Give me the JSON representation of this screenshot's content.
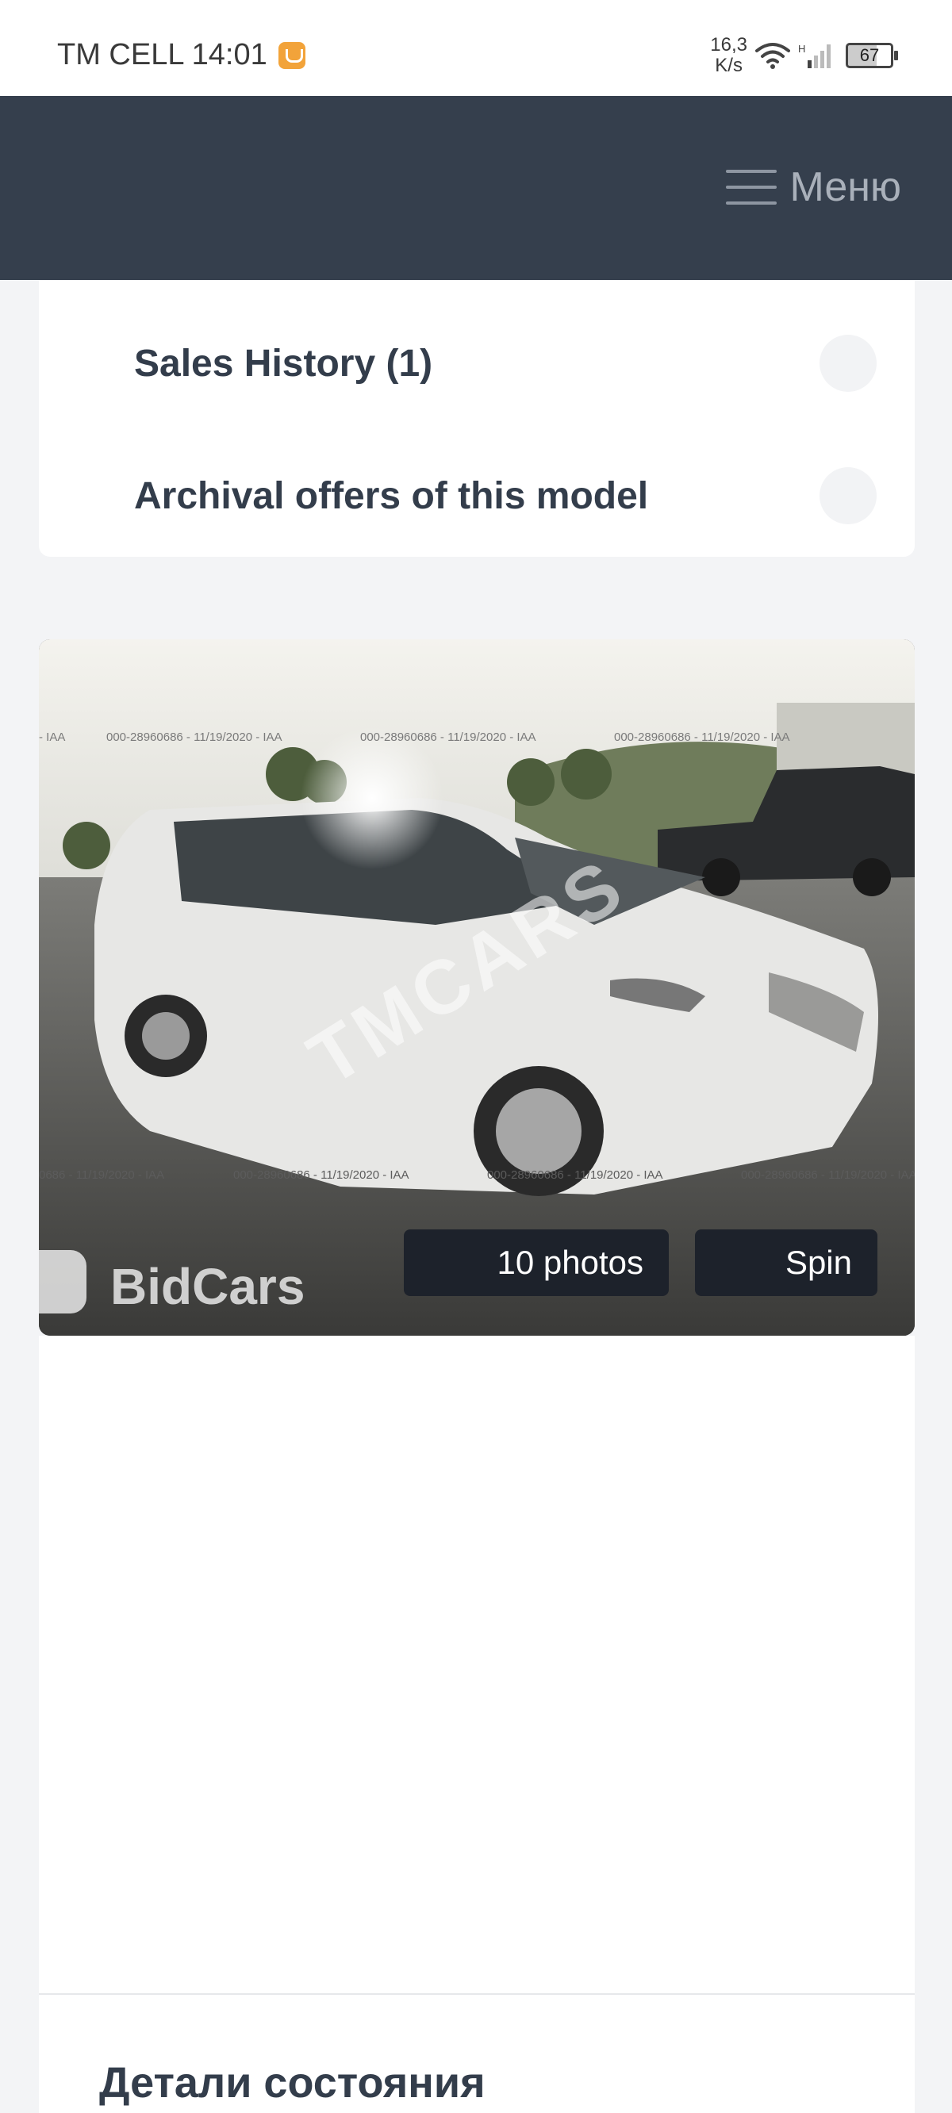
{
  "status_bar": {
    "carrier_time": "TM CELL 14:01",
    "net_speed_value": "16,3",
    "net_speed_unit": "K/s",
    "battery": "67"
  },
  "header": {
    "menu_label": "Меню"
  },
  "sections": [
    {
      "label": "Sales History (1)"
    },
    {
      "label": "Archival offers of this model"
    }
  ],
  "photo": {
    "watermark": "TMCARS",
    "source_logo": "BidCars",
    "stamp_text": "000-28960686 - 11/19/2020 - IAA",
    "photos_button": "10 photos",
    "spin_button": "Spin"
  },
  "details": {
    "title": "Детали состояния"
  }
}
